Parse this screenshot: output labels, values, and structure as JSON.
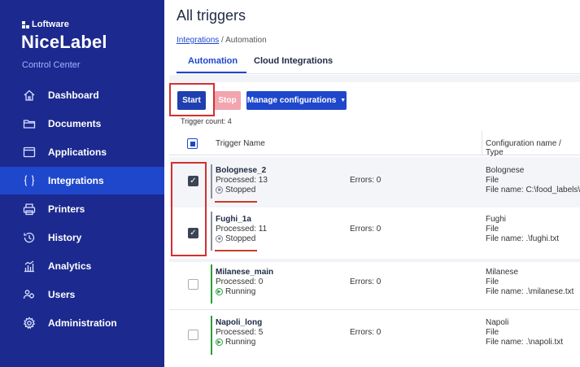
{
  "brand": {
    "company": "Loftware",
    "product": "NiceLabel",
    "subtitle": "Control Center"
  },
  "sidebar": {
    "items": [
      {
        "label": "Dashboard",
        "icon": "home-icon"
      },
      {
        "label": "Documents",
        "icon": "folder-icon"
      },
      {
        "label": "Applications",
        "icon": "window-icon"
      },
      {
        "label": "Integrations",
        "icon": "braces-icon",
        "active": true
      },
      {
        "label": "Printers",
        "icon": "printer-icon"
      },
      {
        "label": "History",
        "icon": "history-icon"
      },
      {
        "label": "Analytics",
        "icon": "analytics-icon"
      },
      {
        "label": "Users",
        "icon": "users-icon"
      },
      {
        "label": "Administration",
        "icon": "gear-icon"
      }
    ]
  },
  "page": {
    "title": "All triggers",
    "breadcrumb": {
      "link": "Integrations",
      "separator": " / ",
      "current": "Automation"
    },
    "tabs": [
      {
        "label": "Automation",
        "active": true
      },
      {
        "label": "Cloud Integrations"
      }
    ]
  },
  "toolbar": {
    "start_label": "Start",
    "stop_label": "Stop",
    "manage_label": "Manage configurations",
    "caret": "▼"
  },
  "trigger_count": "Trigger count: 4",
  "table": {
    "headers": {
      "name": "Trigger Name",
      "config": "Configuration name / Type"
    },
    "rows": [
      {
        "name": "Bolognese_2",
        "processed": "Processed: 13",
        "state": "Stopped",
        "errors": "Errors: 0",
        "config_name": "Bolognese",
        "config_type": "File",
        "file": "File name: C:\\food_labels\\A",
        "checked": true
      },
      {
        "name": "Fughi_1a",
        "processed": "Processed: 11",
        "state": "Stopped",
        "errors": "Errors: 0",
        "config_name": "Fughi",
        "config_type": "File",
        "file": "File name: .\\fughi.txt",
        "checked": true
      },
      {
        "name": "Milanese_main",
        "processed": "Processed: 0",
        "state": "Running",
        "errors": "Errors: 0",
        "config_name": "Milanese",
        "config_type": "File",
        "file": "File name: .\\milanese.txt",
        "checked": false
      },
      {
        "name": "Napoli_long",
        "processed": "Processed: 5",
        "state": "Running",
        "errors": "Errors: 0",
        "config_name": "Napoli",
        "config_type": "File",
        "file": "File name: .\\napoli.txt",
        "checked": false
      }
    ]
  },
  "colors": {
    "sidebar": "#1c2a8f",
    "active_nav": "#1f47cc",
    "accent": "#1f47cc",
    "stopped": "#7a8090",
    "running": "#2e9b3e",
    "annotation": "#d23030"
  }
}
